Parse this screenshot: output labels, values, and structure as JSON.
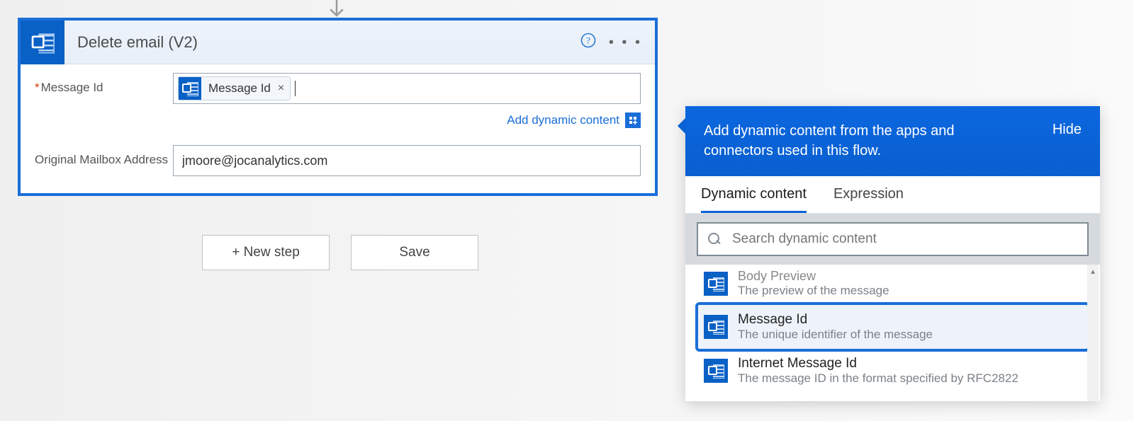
{
  "arrow": {
    "glyph": "↓"
  },
  "card": {
    "title": "Delete email (V2)",
    "help_icon": "?",
    "more_icon": "• • •",
    "fields": {
      "message_id": {
        "label": "Message Id",
        "required_marker": "*",
        "token_label": "Message Id",
        "token_remove": "×"
      },
      "dyn_link": {
        "text": "Add dynamic content",
        "badge": "+"
      },
      "mailbox": {
        "label": "Original Mailbox Address",
        "value": "jmoore@jocanalytics.com"
      }
    }
  },
  "buttons": {
    "new_step": "+ New step",
    "save": "Save"
  },
  "panel": {
    "header_msg": "Add dynamic content from the apps and connectors used in this flow.",
    "hide": "Hide",
    "tabs": {
      "dynamic": "Dynamic content",
      "expression": "Expression"
    },
    "search_placeholder": "Search dynamic content",
    "items": [
      {
        "title": "Body Preview",
        "desc": "The preview of the message",
        "partial": true
      },
      {
        "title": "Message Id",
        "desc": "The unique identifier of the message",
        "selected": true
      },
      {
        "title": "Internet Message Id",
        "desc": "The message ID in the format specified by RFC2822"
      }
    ],
    "scroll_up": "▴"
  }
}
